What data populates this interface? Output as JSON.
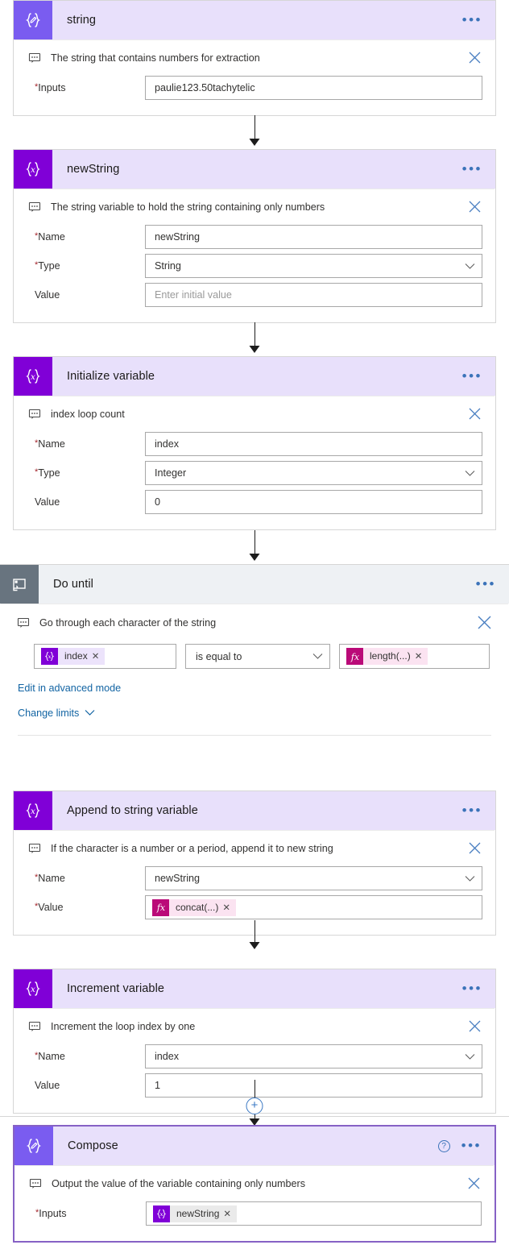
{
  "flow": {
    "cards": [
      {
        "id": "string",
        "title": "string",
        "icon": "compose-icon",
        "comment": "The string that contains numbers for extraction",
        "fields": [
          {
            "label": "Inputs",
            "required": true,
            "value": "paulie123.50tachytelic",
            "control": "text"
          }
        ]
      },
      {
        "id": "newString",
        "title": "newString",
        "icon": "variable-icon",
        "comment": "The string variable to hold the string containing only numbers",
        "fields": [
          {
            "label": "Name",
            "required": true,
            "value": "newString",
            "control": "text"
          },
          {
            "label": "Type",
            "required": true,
            "value": "String",
            "control": "select"
          },
          {
            "label": "Value",
            "required": false,
            "value": "",
            "placeholder": "Enter initial value",
            "control": "text"
          }
        ]
      },
      {
        "id": "initializeVariable",
        "title": "Initialize variable",
        "icon": "variable-icon",
        "comment": "index loop count",
        "fields": [
          {
            "label": "Name",
            "required": true,
            "value": "index",
            "control": "text"
          },
          {
            "label": "Type",
            "required": true,
            "value": "Integer",
            "control": "select"
          },
          {
            "label": "Value",
            "required": false,
            "value": "0",
            "control": "text"
          }
        ]
      },
      {
        "id": "doUntil",
        "title": "Do until",
        "icon": "loop-icon",
        "comment": "Go through each character of the string",
        "condition": {
          "left_token": {
            "kind": "variable",
            "label": "index"
          },
          "operator": "is equal to",
          "right_token": {
            "kind": "expression",
            "label": "length(...)"
          }
        },
        "links": [
          {
            "label": "Edit in advanced mode",
            "chevron": false
          },
          {
            "label": "Change limits",
            "chevron": true
          }
        ]
      },
      {
        "id": "appendToStringVariable",
        "title": "Append to string variable",
        "icon": "variable-icon",
        "comment": "If the character is a number or a period, append it to new string",
        "fields": [
          {
            "label": "Name",
            "required": true,
            "value": "newString",
            "control": "select"
          },
          {
            "label": "Value",
            "required": true,
            "control": "token",
            "token": {
              "kind": "expression",
              "label": "concat(...)"
            }
          }
        ]
      },
      {
        "id": "incrementVariable",
        "title": "Increment variable",
        "icon": "variable-icon",
        "comment": "Increment the loop index by one",
        "fields": [
          {
            "label": "Name",
            "required": true,
            "value": "index",
            "control": "select"
          },
          {
            "label": "Value",
            "required": false,
            "value": "1",
            "control": "text"
          }
        ]
      },
      {
        "id": "compose",
        "title": "Compose",
        "icon": "compose-icon",
        "selected": true,
        "help": "?",
        "comment": "Output the value of the variable containing only numbers",
        "fields": [
          {
            "label": "Inputs",
            "required": true,
            "control": "token",
            "token": {
              "kind": "variable-gray",
              "label": "newString"
            }
          }
        ]
      }
    ],
    "menu_glyph": "•••",
    "token_remove_glyph": "✕",
    "add_step_glyph": "+",
    "colors": {
      "header_purple": "#e8e0fb",
      "header_gray": "#eef1f4",
      "icon_violet": "#7a5cf0",
      "icon_purple": "#8000d7",
      "icon_gray": "#68747f",
      "token_fx": "#ba0a78",
      "link_blue": "#1264a3",
      "required_red": "#a4262c",
      "selected_border": "#8661c5"
    }
  }
}
